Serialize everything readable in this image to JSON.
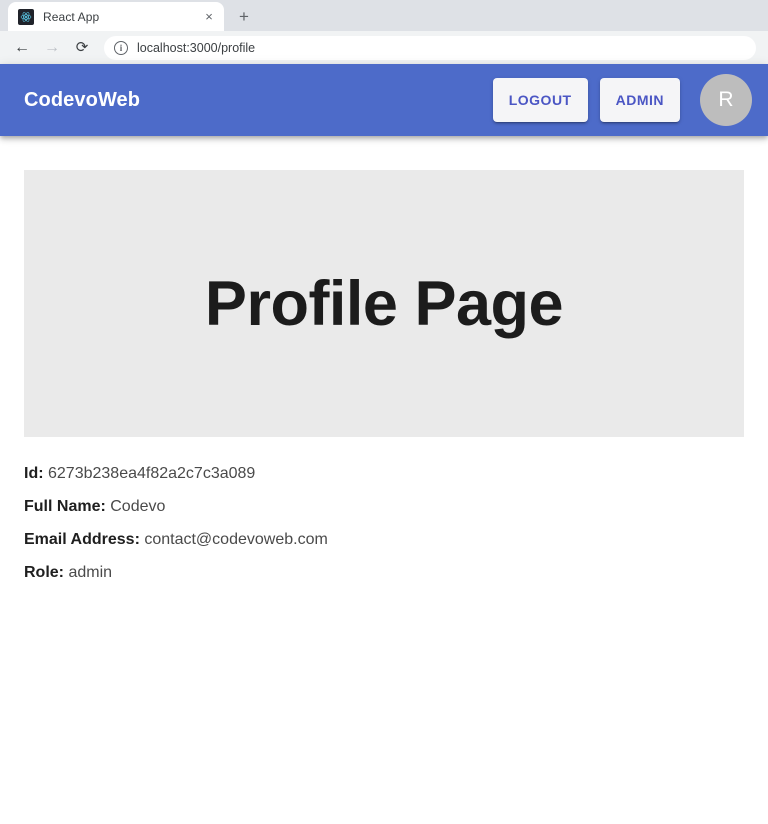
{
  "browser": {
    "tab": {
      "title": "React App",
      "favicon_icon": "react-logo-icon",
      "close_icon": "×"
    },
    "new_tab_icon": "+",
    "toolbar": {
      "back_icon": "←",
      "forward_icon": "→",
      "reload_icon": "⟳",
      "site_info_icon": "i",
      "url": "localhost:3000/profile"
    }
  },
  "navbar": {
    "brand": "CodevoWeb",
    "background_color": "#4d6bc9",
    "buttons": [
      {
        "label": "LOGOUT",
        "name": "logout-button"
      },
      {
        "label": "ADMIN",
        "name": "admin-button"
      }
    ],
    "avatar": {
      "initial": "R",
      "background_color": "#bdbdbd"
    }
  },
  "main": {
    "hero": {
      "title": "Profile Page",
      "background_color": "#eaeaea"
    },
    "details": [
      {
        "label": "Id:",
        "value": "6273b238ea4f82a2c7c3a089"
      },
      {
        "label": "Full Name:",
        "value": "Codevo"
      },
      {
        "label": "Email Address:",
        "value": "contact@codevoweb.com"
      },
      {
        "label": "Role:",
        "value": "admin"
      }
    ]
  }
}
